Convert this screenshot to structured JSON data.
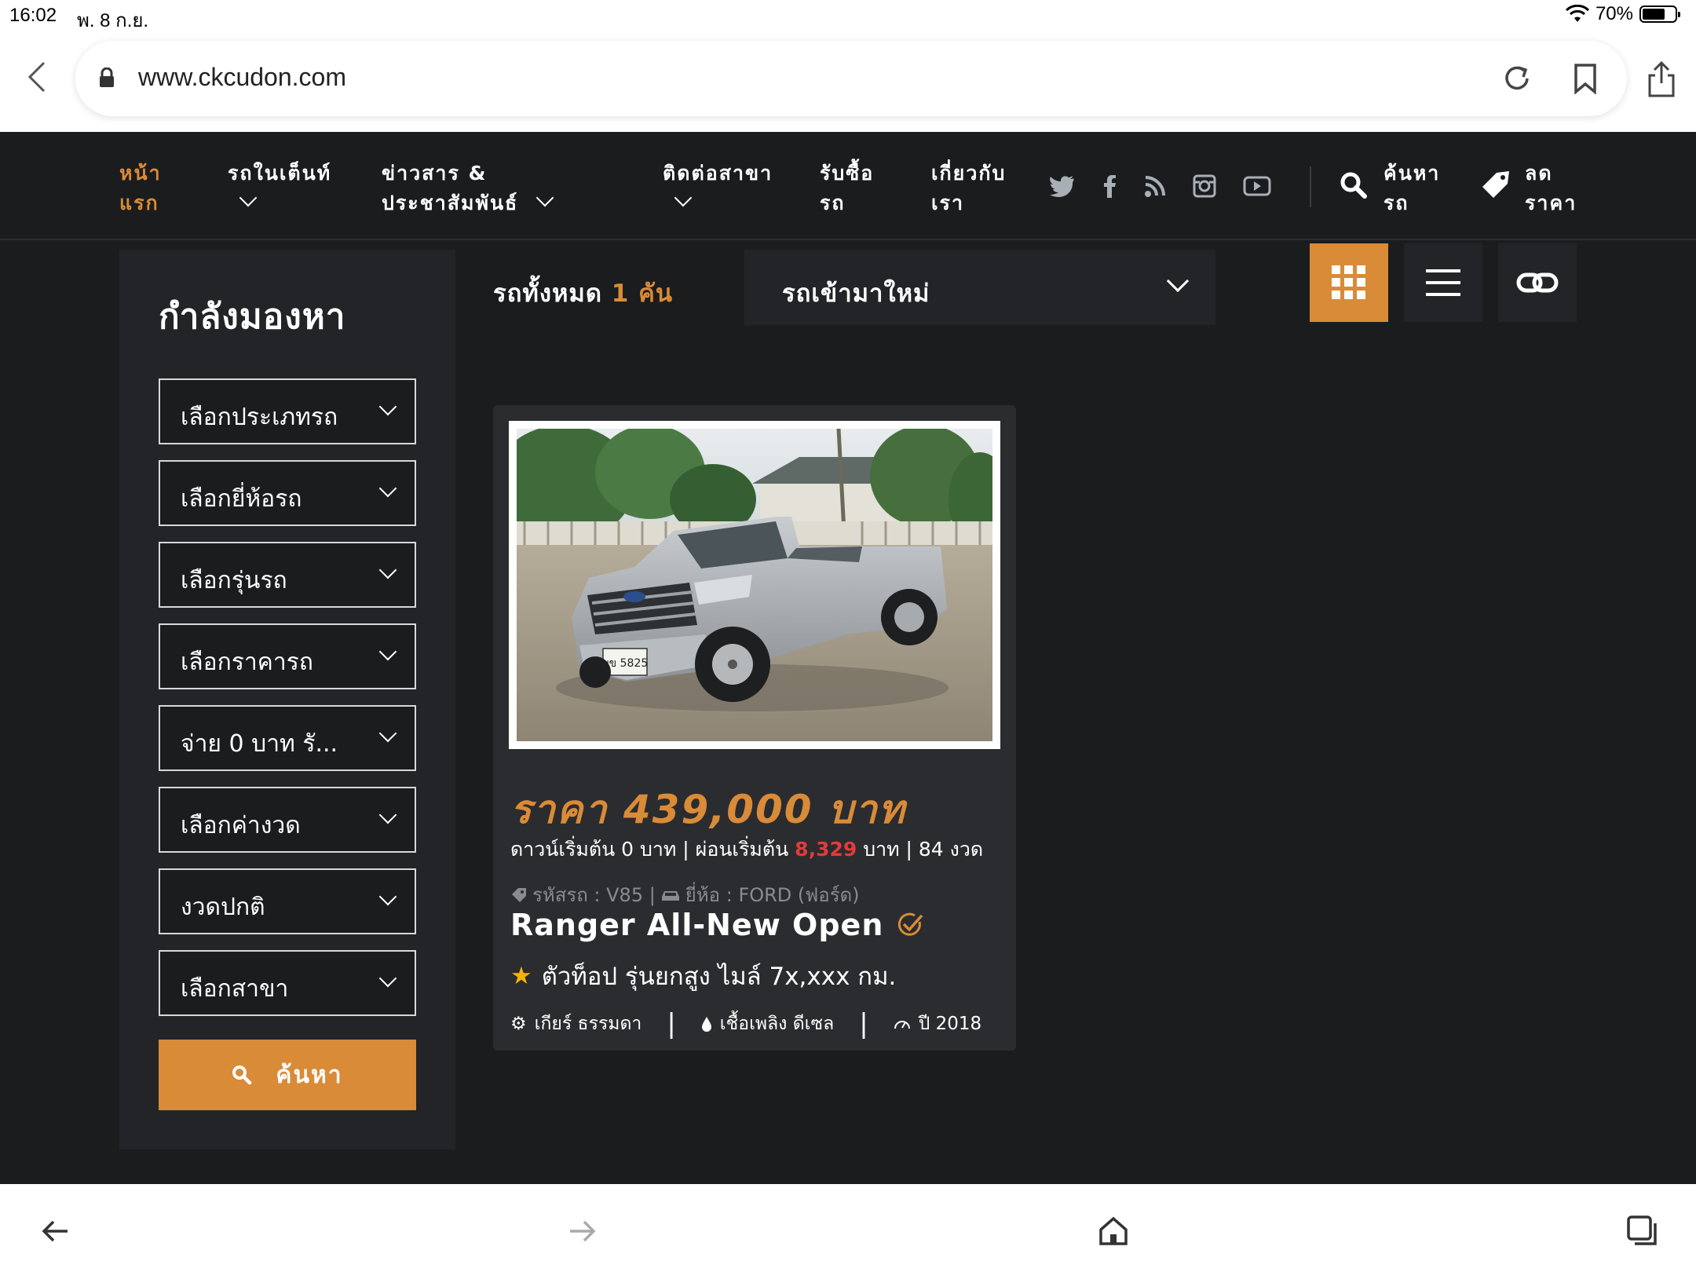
{
  "status": {
    "time": "16:02",
    "date": "พ. 8 ก.ย.",
    "battery": "70%",
    "battery_level": 0.7
  },
  "browser": {
    "url": "www.ckcudon.com"
  },
  "nav": {
    "home": "หน้าแรก",
    "tent_cars": "รถในเต็นท์",
    "news": "ข่าวสาร &\nประชาสัมพันธ์",
    "contact": "ติดต่อสาขา",
    "buy": "รับซื้อ\nรถ",
    "about": "เกี่ยวกับ\nเรา",
    "search": "ค้นหา\nรถ",
    "discount": "ลด\nราคา"
  },
  "sidebar": {
    "title": "กำลังมองหา",
    "filters": [
      "เลือกประเภทรถ",
      "เลือกยี่ห้อรถ",
      "เลือกรุ่นรถ",
      "เลือกราคารถ",
      "จ่าย 0 บาท รั...",
      "เลือกค่างวด",
      "งวดปกติ",
      "เลือกสาขา"
    ],
    "search_button": "ค้นหา"
  },
  "results": {
    "count_prefix": "รถทั้งหมด",
    "count": "1",
    "count_suffix": "คัน",
    "sort": "รถเข้ามาใหม่"
  },
  "card": {
    "price": "ราคา 439,000 บาท",
    "finance_prefix": "ดาวน์เริ่มต้น 0 บาท | ผ่อนเริ่มต้น",
    "finance_amount": "8,329",
    "finance_suffix": "บาท | 84 งวด",
    "code": "รหัสรถ : V85 |",
    "brand": "ยี่ห้อ : FORD (ฟอร์ด)",
    "title": "Ranger All-New Open",
    "subtitle": "ตัวท็อป รุ่นยกสูง ไมล์ 7x,xxx กม.",
    "gear": "เกียร์ ธรรมดา",
    "fuel": "เชื้อเพลิง ดีเซล",
    "year": "ปี 2018",
    "plate": "บข 5825"
  },
  "colors": {
    "accent": "#d98b38",
    "background": "#1b1c1e",
    "panel": "#232427",
    "red": "#e23b3b"
  }
}
